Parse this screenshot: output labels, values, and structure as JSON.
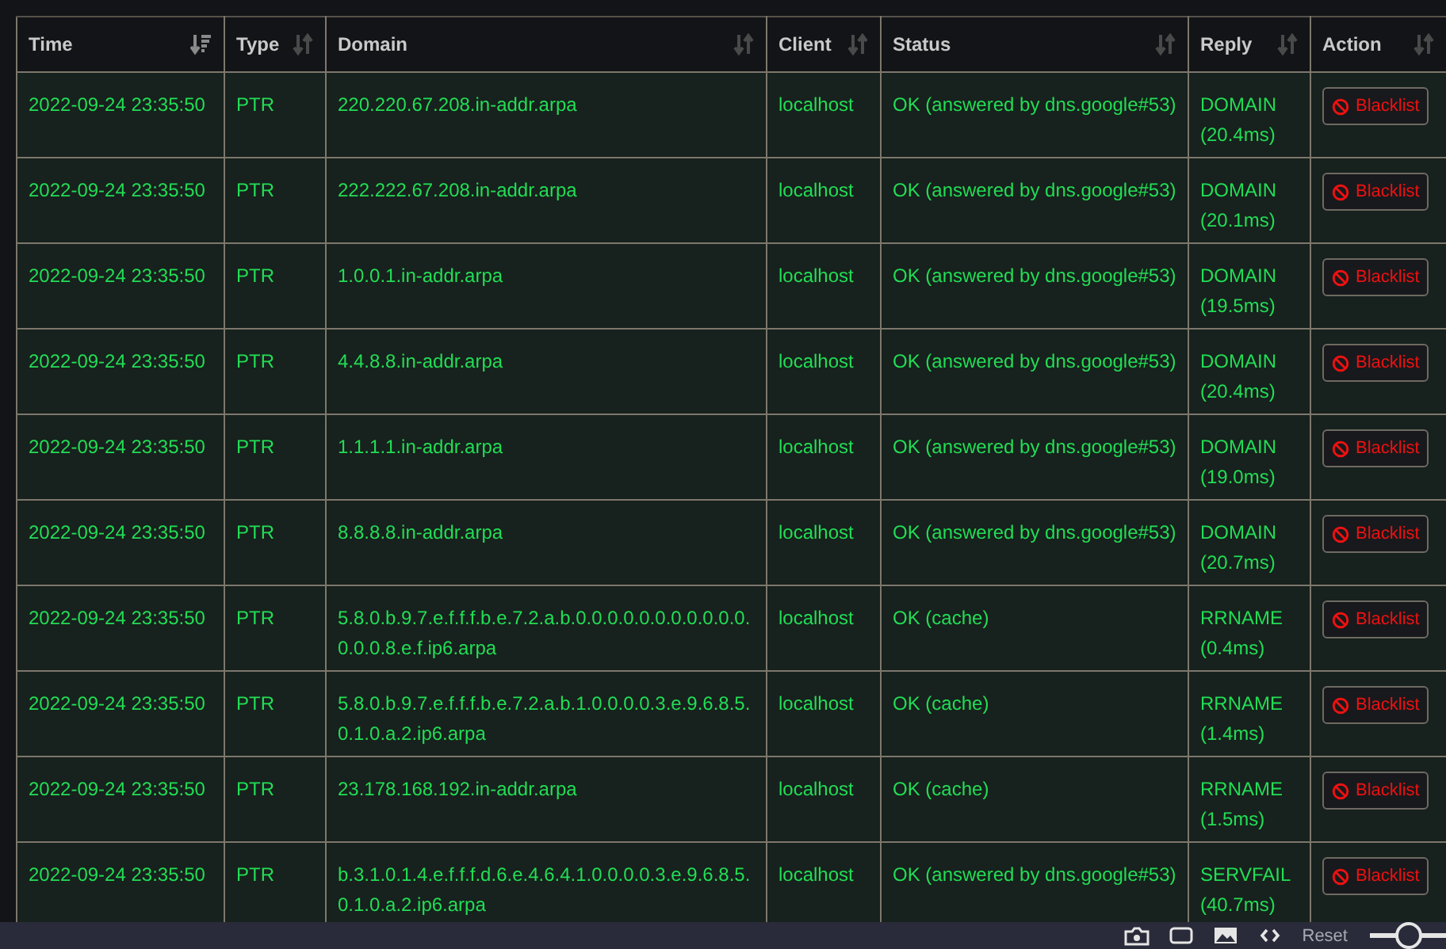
{
  "table": {
    "columns": [
      {
        "label": "Time",
        "sorted": true
      },
      {
        "label": "Type",
        "sorted": false
      },
      {
        "label": "Domain",
        "sorted": false
      },
      {
        "label": "Client",
        "sorted": false
      },
      {
        "label": "Status",
        "sorted": false
      },
      {
        "label": "Reply",
        "sorted": false
      },
      {
        "label": "Action",
        "sorted": false
      }
    ],
    "rows": [
      {
        "time": "2022-09-24 23:35:50",
        "type": "PTR",
        "domain": "220.220.67.208.in-addr.arpa",
        "client": "localhost",
        "status": "OK (answered by dns.google#53)",
        "reply": "DOMAIN",
        "reply_time": "(20.4ms)",
        "action": "Blacklist"
      },
      {
        "time": "2022-09-24 23:35:50",
        "type": "PTR",
        "domain": "222.222.67.208.in-addr.arpa",
        "client": "localhost",
        "status": "OK (answered by dns.google#53)",
        "reply": "DOMAIN",
        "reply_time": "(20.1ms)",
        "action": "Blacklist"
      },
      {
        "time": "2022-09-24 23:35:50",
        "type": "PTR",
        "domain": "1.0.0.1.in-addr.arpa",
        "client": "localhost",
        "status": "OK (answered by dns.google#53)",
        "reply": "DOMAIN",
        "reply_time": "(19.5ms)",
        "action": "Blacklist"
      },
      {
        "time": "2022-09-24 23:35:50",
        "type": "PTR",
        "domain": "4.4.8.8.in-addr.arpa",
        "client": "localhost",
        "status": "OK (answered by dns.google#53)",
        "reply": "DOMAIN",
        "reply_time": "(20.4ms)",
        "action": "Blacklist"
      },
      {
        "time": "2022-09-24 23:35:50",
        "type": "PTR",
        "domain": "1.1.1.1.in-addr.arpa",
        "client": "localhost",
        "status": "OK (answered by dns.google#53)",
        "reply": "DOMAIN",
        "reply_time": "(19.0ms)",
        "action": "Blacklist"
      },
      {
        "time": "2022-09-24 23:35:50",
        "type": "PTR",
        "domain": "8.8.8.8.in-addr.arpa",
        "client": "localhost",
        "status": "OK (answered by dns.google#53)",
        "reply": "DOMAIN",
        "reply_time": "(20.7ms)",
        "action": "Blacklist"
      },
      {
        "time": "2022-09-24 23:35:50",
        "type": "PTR",
        "domain": "5.8.0.b.9.7.e.f.f.f.b.e.7.2.a.b.0.0.0.0.0.0.0.0.0.0.0.0.0.0.8.e.f.ip6.arpa",
        "client": "localhost",
        "status": "OK (cache)",
        "reply": "RRNAME",
        "reply_time": "(0.4ms)",
        "action": "Blacklist"
      },
      {
        "time": "2022-09-24 23:35:50",
        "type": "PTR",
        "domain": "5.8.0.b.9.7.e.f.f.f.b.e.7.2.a.b.1.0.0.0.0.3.e.9.6.8.5.0.1.0.a.2.ip6.arpa",
        "client": "localhost",
        "status": "OK (cache)",
        "reply": "RRNAME",
        "reply_time": "(1.4ms)",
        "action": "Blacklist"
      },
      {
        "time": "2022-09-24 23:35:50",
        "type": "PTR",
        "domain": "23.178.168.192.in-addr.arpa",
        "client": "localhost",
        "status": "OK (cache)",
        "reply": "RRNAME",
        "reply_time": "(1.5ms)",
        "action": "Blacklist"
      },
      {
        "time": "2022-09-24 23:35:50",
        "type": "PTR",
        "domain": "b.3.1.0.1.4.e.f.f.f.d.6.e.4.6.4.1.0.0.0.0.3.e.9.6.8.5.0.1.0.a.2.ip6.arpa",
        "client": "localhost",
        "status": "OK (answered by dns.google#53)",
        "reply": "SERVFAIL",
        "reply_time": "(40.7ms)",
        "action": "Blacklist"
      }
    ]
  },
  "toolbar": {
    "reset": "Reset",
    "zoom": {
      "level": 0.5
    }
  }
}
